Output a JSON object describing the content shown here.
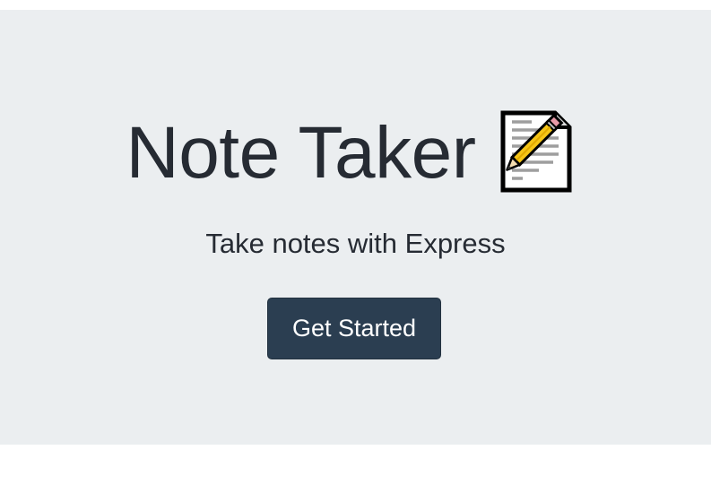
{
  "hero": {
    "title": "Note Taker",
    "title_icon": "memo-pencil-icon",
    "subtitle": "Take notes with Express",
    "cta_label": "Get Started"
  },
  "colors": {
    "hero_background": "#ebeef0",
    "page_background": "#ffffff",
    "text": "#262b33",
    "button_background": "#2b3e51",
    "button_text": "#ffffff"
  }
}
